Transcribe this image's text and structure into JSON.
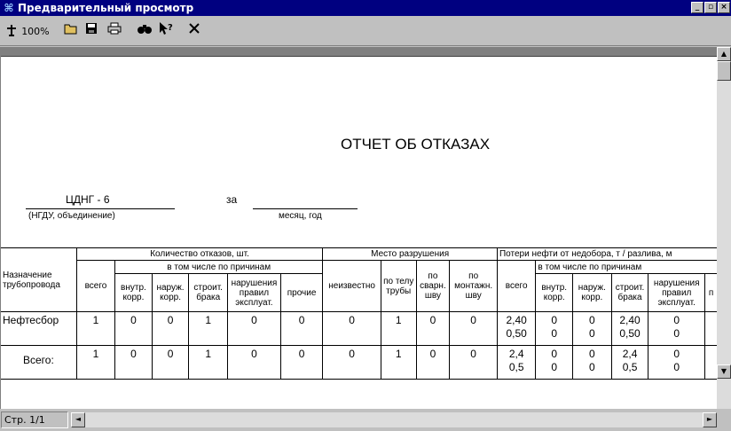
{
  "window": {
    "title": "Предварительный просмотр",
    "controls": {
      "minimize": "_",
      "maximize": "▫",
      "close": "×"
    }
  },
  "toolbar": {
    "zoom_label": "100%",
    "icons": [
      "zoom-icon",
      "open-folder-icon",
      "save-icon",
      "print-icon",
      "find-icon",
      "context-help-icon",
      "close-icon"
    ]
  },
  "report": {
    "title": "ОТЧЕТ ОБ ОТКАЗАХ",
    "org_value": "ЦДНГ - 6",
    "org_caption": "(НГДУ, объединение)",
    "period_label": "за",
    "period_caption": "месяц, год"
  },
  "table": {
    "col_pipeline": "Назначение трубопровода",
    "group_failures": "Количество отказов, шт.",
    "group_location": "Место разрушения",
    "group_losses": "Потери нефти от недобора, т / разлива, м",
    "subgroup_causes": "в том числе по причинам",
    "col_total": "всего",
    "col_internal_corr": "внутр. корр.",
    "col_external_corr": "наруж. корр.",
    "col_build_defect": "строит. брака",
    "col_operation_violation": "нарушения правил эксплуат.",
    "col_other": "прочие",
    "col_unknown": "неизвестно",
    "col_pipe_body": "по телу трубы",
    "col_weld_seam": "по сварн. шву",
    "col_assembly_seam": "по монтажн. шву",
    "col_cut": "п",
    "rows": [
      {
        "name": "Нефтесбор",
        "total": "1",
        "internal_corr": "0",
        "external_corr": "0",
        "build_defect": "1",
        "operation_violation": "0",
        "other": "0",
        "unknown": "0",
        "pipe_body": "1",
        "weld_seam": "0",
        "assembly_seam": "0",
        "loss_total": [
          "2,40",
          "0,50"
        ],
        "loss_internal": [
          "0",
          "0"
        ],
        "loss_external": [
          "0",
          "0"
        ],
        "loss_build": [
          "2,40",
          "0,50"
        ],
        "loss_operation": [
          "0",
          "0"
        ]
      },
      {
        "name": "Всего:",
        "total": "1",
        "internal_corr": "0",
        "external_corr": "0",
        "build_defect": "1",
        "operation_violation": "0",
        "other": "0",
        "unknown": "0",
        "pipe_body": "1",
        "weld_seam": "0",
        "assembly_seam": "0",
        "loss_total": [
          "2,4",
          "0,5"
        ],
        "loss_internal": [
          "0",
          "0"
        ],
        "loss_external": [
          "0",
          "0"
        ],
        "loss_build": [
          "2,4",
          "0,5"
        ],
        "loss_operation": [
          "0",
          "0"
        ]
      }
    ]
  },
  "status": {
    "page_indicator": "Стр. 1/1"
  },
  "scroll": {
    "up": "▲",
    "down": "▼",
    "left": "◄",
    "right": "►"
  }
}
